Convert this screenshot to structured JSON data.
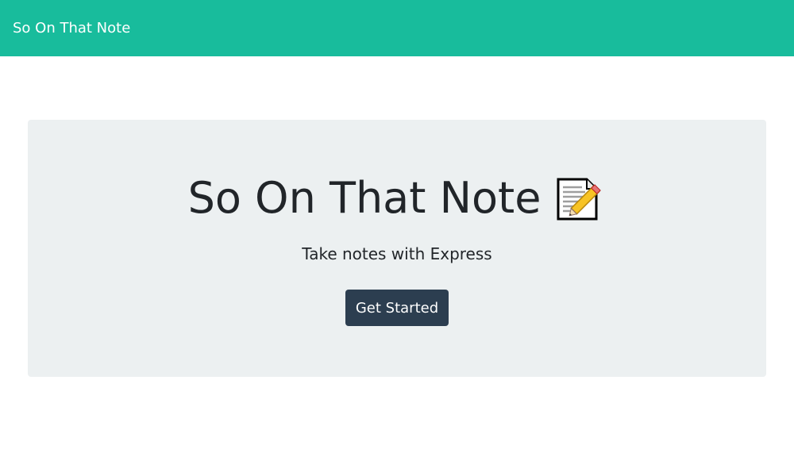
{
  "navbar": {
    "brand": "So On That Note",
    "color": "#18bc9c"
  },
  "hero": {
    "title": "So On That Note",
    "title_icon": "memo-icon",
    "subtitle": "Take notes with Express",
    "button_label": "Get Started",
    "background": "#ecf0f1",
    "button_color": "#2c3e50"
  }
}
